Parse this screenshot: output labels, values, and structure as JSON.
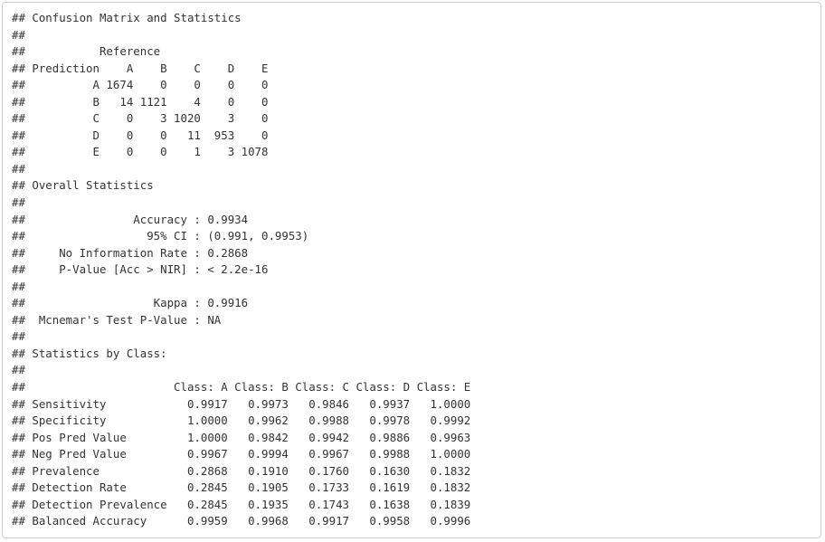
{
  "output": {
    "lines": [
      "## Confusion Matrix and Statistics",
      "## ",
      "##           Reference",
      "## Prediction    A    B    C    D    E",
      "##          A 1674    0    0    0    0",
      "##          B   14 1121    4    0    0",
      "##          C    0    3 1020    3    0",
      "##          D    0    0   11  953    0",
      "##          E    0    0    1    3 1078",
      "## ",
      "## Overall Statistics",
      "##                                           ",
      "##                Accuracy : 0.9934          ",
      "##                  95% CI : (0.991, 0.9953)",
      "##     No Information Rate : 0.2868          ",
      "##     P-Value [Acc > NIR] : < 2.2e-16       ",
      "##                                           ",
      "##                   Kappa : 0.9916          ",
      "##  Mcnemar's Test P-Value : NA              ",
      "## ",
      "## Statistics by Class:",
      "## ",
      "##                      Class: A Class: B Class: C Class: D Class: E",
      "## Sensitivity            0.9917   0.9973   0.9846   0.9937   1.0000",
      "## Specificity            1.0000   0.9962   0.9988   0.9978   0.9992",
      "## Pos Pred Value         1.0000   0.9842   0.9942   0.9886   0.9963",
      "## Neg Pred Value         0.9967   0.9994   0.9967   0.9988   1.0000",
      "## Prevalence             0.2868   0.1910   0.1760   0.1630   0.1832",
      "## Detection Rate         0.2845   0.1905   0.1733   0.1619   0.1832",
      "## Detection Prevalence   0.2845   0.1935   0.1743   0.1638   0.1839",
      "## Balanced Accuracy      0.9959   0.9968   0.9917   0.9958   0.9996"
    ]
  }
}
